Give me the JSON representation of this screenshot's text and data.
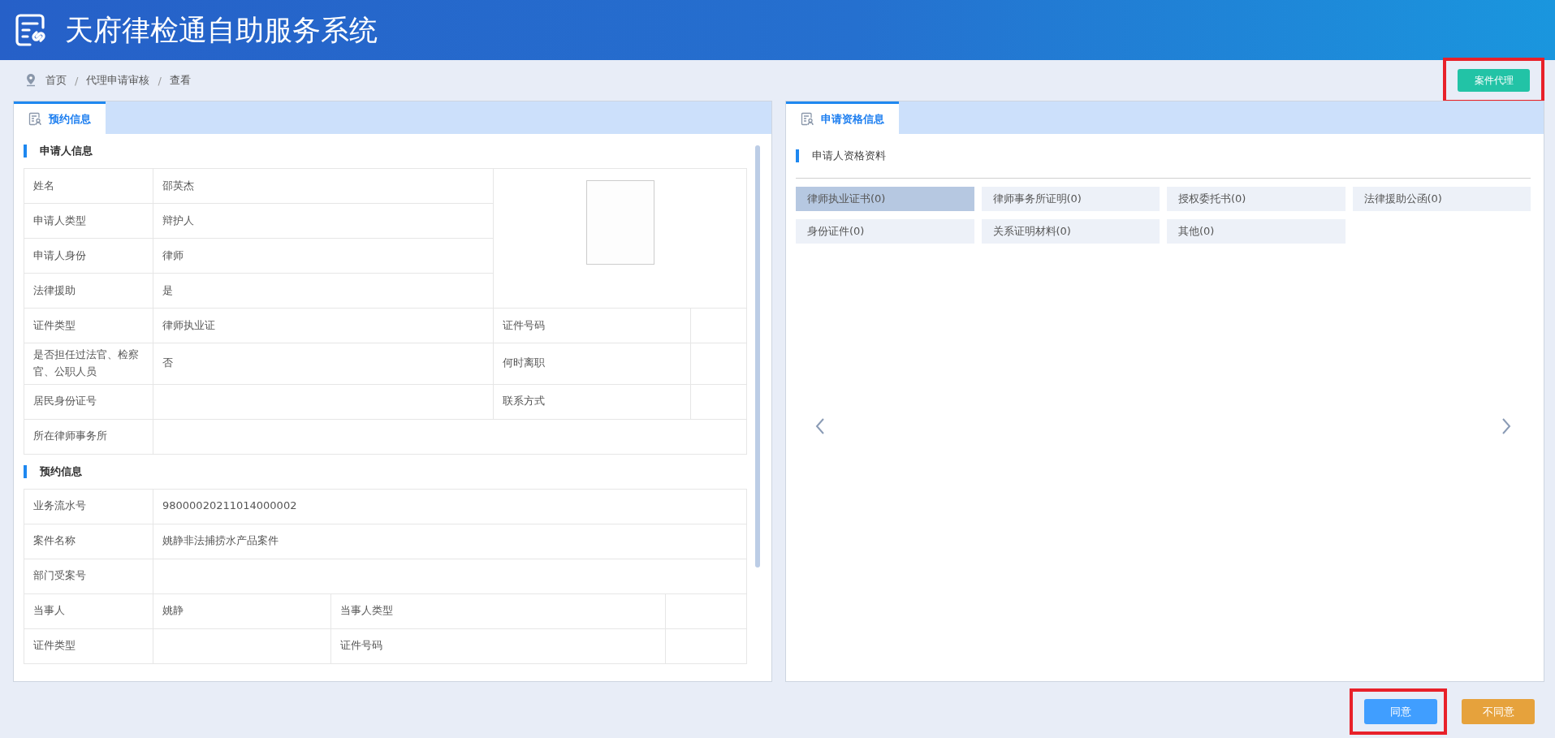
{
  "header": {
    "title": "天府律检通自助服务系统"
  },
  "breadcrumb": [
    {
      "kind": "link",
      "label": "首页"
    },
    {
      "kind": "separator",
      "label": "/"
    },
    {
      "kind": "link",
      "label": "代理申请审核"
    },
    {
      "kind": "separator",
      "label": "/"
    },
    {
      "kind": "link",
      "label": "查看"
    }
  ],
  "top_button": {
    "label": "案件代理",
    "highlighted": true
  },
  "left_panel": {
    "tabs": [
      {
        "label": "预约信息",
        "selected": true
      }
    ],
    "applicant": {
      "title": "申请人信息",
      "rows": [
        {
          "kind": "single",
          "label": "姓名",
          "value": "邵英杰"
        },
        {
          "kind": "single",
          "label": "申请人类型",
          "value": "辩护人"
        },
        {
          "kind": "single",
          "label": "申请人身份",
          "value": "律师"
        },
        {
          "kind": "single",
          "label": "法律援助",
          "value": "是"
        },
        {
          "kind": "double",
          "label": "证件类型",
          "value": "律师执业证",
          "label_2": "证件号码"
        },
        {
          "kind": "double",
          "label": "是否担任过法官、检察官、公职人员",
          "value": "否",
          "label_2": "何时离职"
        },
        {
          "kind": "double",
          "label": "居民身份证号",
          "label_2": "联系方式"
        },
        {
          "kind": "full",
          "label": "所在律师事务所"
        }
      ]
    },
    "appointment": {
      "title": "预约信息",
      "rows": [
        {
          "kind": "full",
          "label": "业务流水号",
          "value": "98000020211014000002"
        },
        {
          "kind": "full",
          "label": "案件名称",
          "value": "姚静非法捕捞水产品案件"
        },
        {
          "kind": "full",
          "label": "部门受案号"
        },
        {
          "kind": "double",
          "label": "当事人",
          "value": "姚静",
          "label_2": "当事人类型"
        },
        {
          "kind": "double",
          "label": "证件类型",
          "label_2": "证件号码"
        }
      ]
    }
  },
  "right_panel": {
    "tabs": [
      {
        "label": "申请资格信息",
        "selected": true
      }
    ],
    "section_title": "申请人资格资料",
    "documents": [
      {
        "label": "律师执业证书(0)",
        "selected": true
      },
      {
        "label": "律师事务所证明(0)",
        "selected": false
      },
      {
        "label": "授权委托书(0)",
        "selected": false
      },
      {
        "label": "法律援助公函(0)",
        "selected": false
      },
      {
        "label": "身份证件(0)",
        "selected": false
      },
      {
        "label": "关系证明材料(0)",
        "selected": false
      },
      {
        "label": "其他(0)",
        "selected": false
      }
    ]
  },
  "footer_buttons": [
    {
      "kind": "primary",
      "label": "同意",
      "highlighted": true
    },
    {
      "kind": "warning",
      "label": "不同意",
      "highlighted": false
    }
  ]
}
